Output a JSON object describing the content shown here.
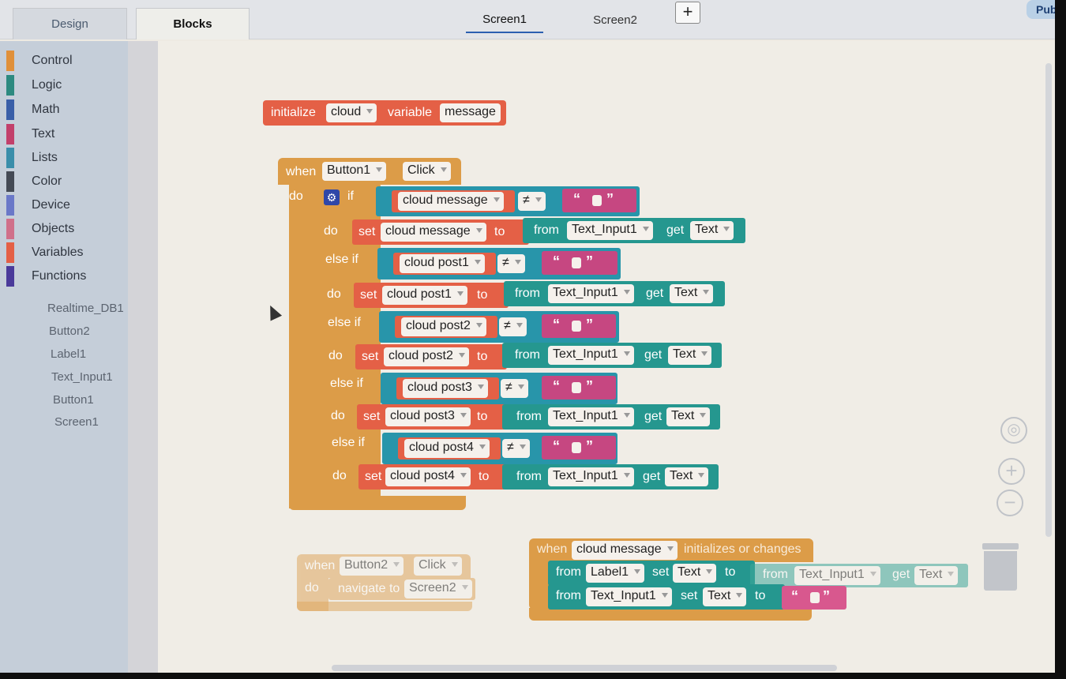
{
  "topbar": {
    "design_tab": "Design",
    "blocks_tab": "Blocks",
    "screen1_tab": "Screen1",
    "screen2_tab": "Screen2",
    "add_screen": "+",
    "publish": "Publi"
  },
  "palette": {
    "categories": [
      {
        "label": "Control",
        "color": "#e0903a"
      },
      {
        "label": "Logic",
        "color": "#2d8a80"
      },
      {
        "label": "Math",
        "color": "#3a5fa8"
      },
      {
        "label": "Text",
        "color": "#c2406b"
      },
      {
        "label": "Lists",
        "color": "#3a8eaa"
      },
      {
        "label": "Color",
        "color": "#444a55"
      },
      {
        "label": "Device",
        "color": "#6a78c8"
      },
      {
        "label": "Objects",
        "color": "#d0708a"
      },
      {
        "label": "Variables",
        "color": "#e46046"
      },
      {
        "label": "Functions",
        "color": "#4a3a9a"
      }
    ],
    "components": [
      "Realtime_DB1",
      "Button2",
      "Label1",
      "Text_Input1",
      "Button1",
      "Screen1"
    ]
  },
  "blocks": {
    "init": {
      "initialize": "initialize",
      "scope": "cloud",
      "variable": "variable",
      "name": "message"
    },
    "event1": {
      "when": "when",
      "component": "Button1",
      "event": "Click",
      "do": "do"
    },
    "if_kw": "if",
    "else_if_kw": "else if",
    "do_kw": "do",
    "set_kw": "set",
    "to_kw": "to",
    "from_kw": "from",
    "get_kw": "get",
    "neq": "≠",
    "text_input": "Text_Input1",
    "text_prop": "Text",
    "vars": [
      "cloud message",
      "cloud post1",
      "cloud post2",
      "cloud post3",
      "cloud post4"
    ],
    "event2": {
      "when": "when",
      "component": "Button2",
      "event": "Click",
      "do": "do",
      "navigate": "navigate to",
      "target": "Screen2"
    },
    "event3": {
      "when": "when",
      "var": "cloud message",
      "trigger": "initializes or changes",
      "row1": {
        "from": "from",
        "component": "Label1",
        "set": "set",
        "prop": "Text",
        "to": "to",
        "src_from": "from",
        "src_component": "Text_Input1",
        "get": "get",
        "src_prop": "Text"
      },
      "row2": {
        "from": "from",
        "component": "Text_Input1",
        "set": "set",
        "prop": "Text",
        "to": "to"
      }
    }
  },
  "quote_open": "“",
  "quote_close": "”"
}
